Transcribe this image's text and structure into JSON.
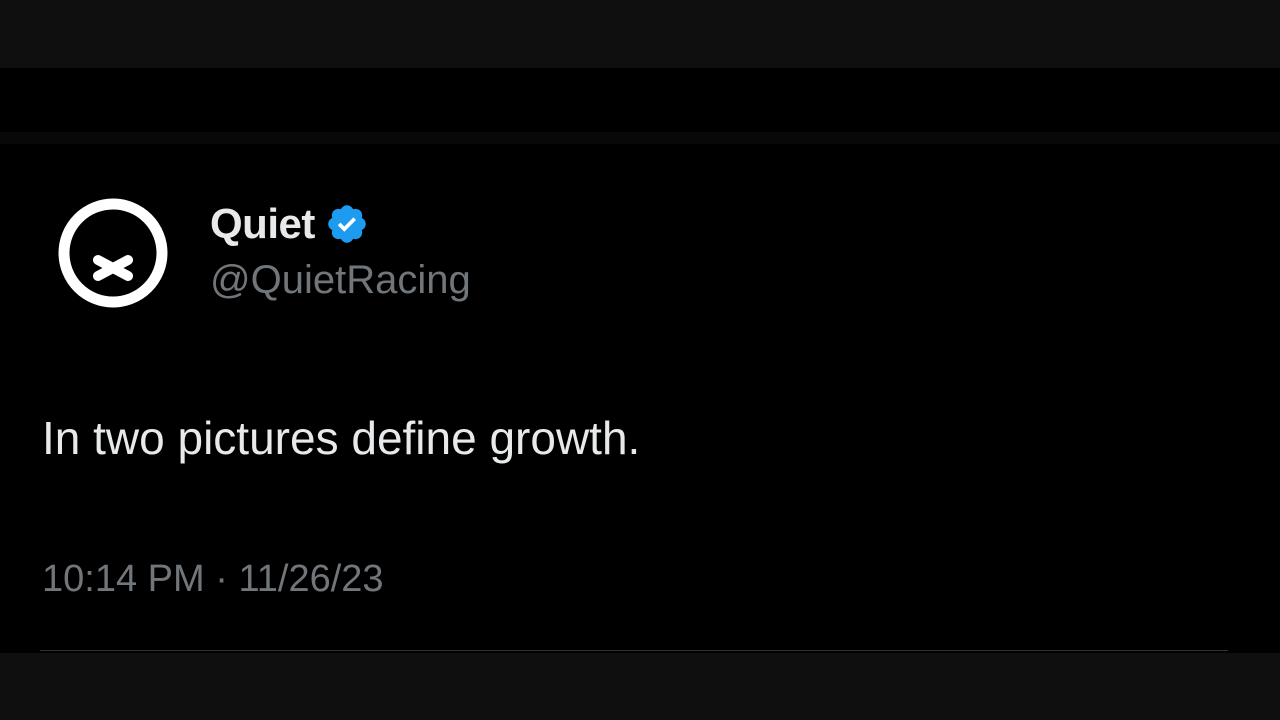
{
  "author": {
    "display_name": "Quiet",
    "handle": "@QuietRacing",
    "verified_icon": "verified-badge-icon",
    "avatar_icon": "x-mark-circle-logo-icon"
  },
  "tweet": {
    "text": "In two pictures define growth.",
    "time": "10:14 PM",
    "separator": "·",
    "date": "11/26/23"
  },
  "colors": {
    "background": "#000000",
    "letterbox": "#0f0f0f",
    "primary_text": "#e7e9ea",
    "secondary_text": "#71767b",
    "verified_blue": "#1d9bf0"
  }
}
